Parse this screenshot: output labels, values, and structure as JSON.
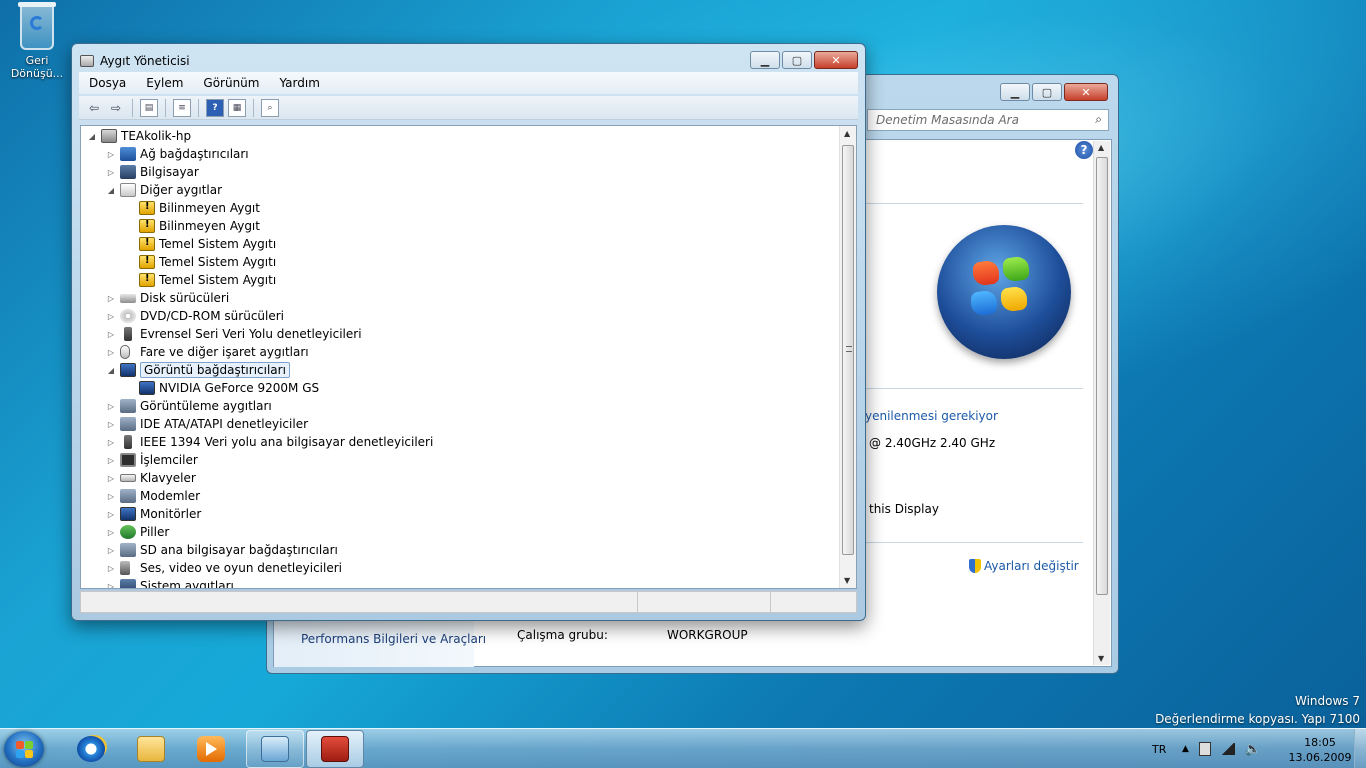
{
  "desktop": {
    "recycle_bin_label": "Geri Dönüşü..."
  },
  "device_manager": {
    "title": "Aygıt Yöneticisi",
    "menu": [
      "Dosya",
      "Eylem",
      "Görünüm",
      "Yardım"
    ],
    "tree": {
      "root": "TEAkolik-hp",
      "items": [
        "Ağ bağdaştırıcıları",
        "Bilgisayar",
        "Diğer aygıtlar",
        "Bilinmeyen Aygıt",
        "Bilinmeyen Aygıt",
        "Temel Sistem Aygıtı",
        "Temel Sistem Aygıtı",
        "Temel Sistem Aygıtı",
        "Disk sürücüleri",
        "DVD/CD-ROM sürücüleri",
        "Evrensel Seri Veri Yolu denetleyicileri",
        "Fare ve diğer işaret aygıtları",
        "Görüntü bağdaştırıcıları",
        "NVIDIA GeForce 9200M GS",
        "Görüntüleme aygıtları",
        "IDE ATA/ATAPI denetleyiciler",
        "IEEE 1394 Veri yolu ana bilgisayar denetleyicileri",
        "İşlemciler",
        "Klavyeler",
        "Modemler",
        "Monitörler",
        "Piller",
        "SD ana bilgisayar bağdaştırıcıları",
        "Ses, video ve oyun denetleyicileri",
        "Sistem aygıtları"
      ]
    }
  },
  "system_window": {
    "search_placeholder": "Denetim Masasında Ara",
    "activation_link": "yenilenmesi gerekiyor",
    "cpu_text": "@ 2.40GHz   2.40 GHz",
    "display_text": "this Display",
    "change_settings": "Ayarları değiştir",
    "sidebar_link": "Performans Bilgileri ve Araçları",
    "workgroup_label": "Çalışma grubu:",
    "workgroup_value": "WORKGROUP"
  },
  "watermark": {
    "line1": "Windows 7",
    "line2": "Değerlendirme kopyası. Yapı 7100"
  },
  "taskbar": {
    "language": "TR",
    "time": "18:05",
    "date": "13.06.2009"
  }
}
